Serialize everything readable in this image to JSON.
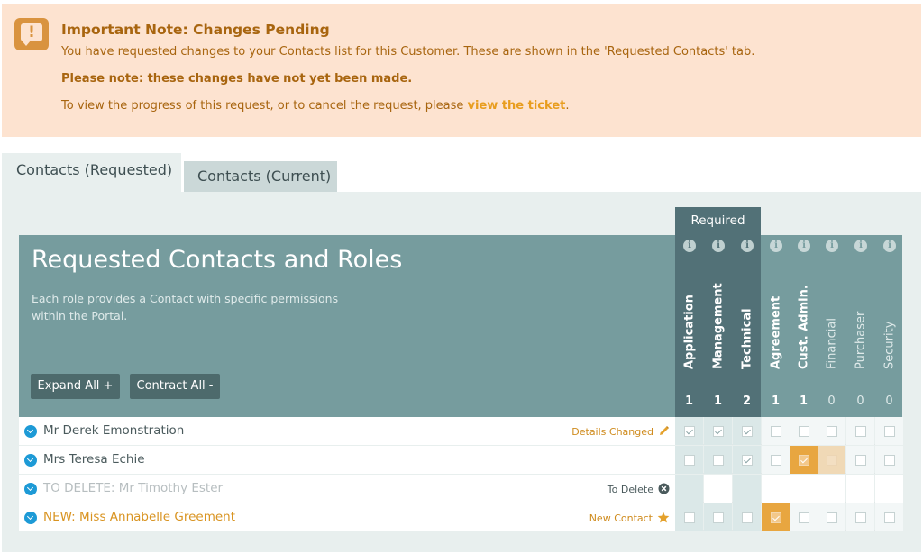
{
  "notice": {
    "title": "Important Note: Changes Pending",
    "line1": "You have requested changes to your Contacts list for this Customer. These are shown in the 'Requested Contacts' tab.",
    "line2": "Please note: these changes have not yet been made.",
    "line3_prefix": "To view the progress of this request, or to cancel the request, please ",
    "line3_link": "view the ticket",
    "line3_suffix": ".",
    "icon": "exclamation-speech-icon"
  },
  "tabs": [
    {
      "label": "Contacts (Requested)",
      "active": true
    },
    {
      "label": "Contacts (Current)",
      "active": false
    }
  ],
  "required_label": "Required",
  "header": {
    "title": "Requested Contacts and Roles",
    "description": "Each role provides a Contact with specific permissions within the Portal.",
    "expand_label": "Expand All +",
    "contract_label": "Contract All -"
  },
  "roles": [
    {
      "label": "Application",
      "count": "1",
      "required": true,
      "strong": true
    },
    {
      "label": "Management",
      "count": "1",
      "required": true,
      "strong": true
    },
    {
      "label": "Technical",
      "count": "2",
      "required": true,
      "strong": true
    },
    {
      "label": "Agreement",
      "count": "1",
      "required": false,
      "strong": true
    },
    {
      "label": "Cust. Admin.",
      "count": "1",
      "required": false,
      "strong": true
    },
    {
      "label": "Financial",
      "count": "0",
      "required": false,
      "strong": false
    },
    {
      "label": "Purchaser",
      "count": "0",
      "required": false,
      "strong": false
    },
    {
      "label": "Security",
      "count": "0",
      "required": false,
      "strong": false
    }
  ],
  "contacts": [
    {
      "name": "Mr Derek Emonstration",
      "status": "Details Changed",
      "status_icon": "pencil-icon",
      "kind": "changed",
      "roles": [
        "checked",
        "checked",
        "checked",
        "empty",
        "empty",
        "empty",
        "empty",
        "empty"
      ]
    },
    {
      "name": "Mrs Teresa Echie",
      "status": "",
      "status_icon": "",
      "kind": "normal",
      "roles": [
        "empty",
        "empty",
        "checked",
        "empty",
        "orange-checked",
        "pale",
        "empty",
        "empty"
      ]
    },
    {
      "name": "TO DELETE: Mr Timothy Ester",
      "status": "To Delete",
      "status_icon": "close-circle-icon",
      "kind": "deleted",
      "roles": [
        "none",
        "none",
        "none",
        "none",
        "none",
        "none",
        "none",
        "none"
      ]
    },
    {
      "name": "NEW: Miss Annabelle Greement",
      "status": "New Contact",
      "status_icon": "star-icon",
      "kind": "new",
      "roles": [
        "empty",
        "empty",
        "empty",
        "orange-checked",
        "empty",
        "empty",
        "empty",
        "empty"
      ]
    }
  ],
  "colors": {
    "notice_bg": "#fde3d0",
    "notice_text": "#a8650f",
    "header_bg": "#769c9e",
    "required_bg": "#527177",
    "accent_orange": "#e8a640",
    "chevron_blue": "#1d9ad6"
  }
}
